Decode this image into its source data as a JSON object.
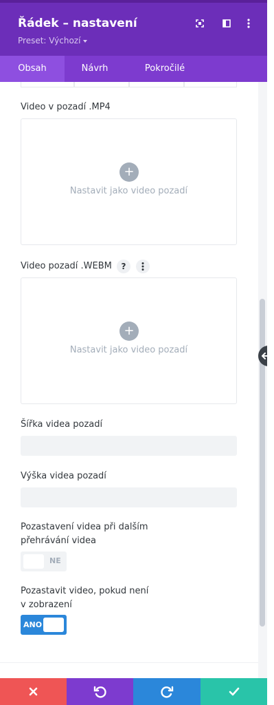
{
  "header": {
    "title": "Řádek – nastavení",
    "preset_label": "Preset: Výchozí",
    "icons": [
      "fullscreen-icon",
      "split-view-icon",
      "more-vertical-icon"
    ],
    "background": "#6c2eb9"
  },
  "tabs": [
    {
      "label": "Obsah",
      "active": true
    },
    {
      "label": "Návrh",
      "active": false
    },
    {
      "label": "Pokročilé",
      "active": false
    }
  ],
  "content": {
    "mp4": {
      "label": "Video v pozadí .MP4",
      "upload_text": "Nastavit jako video pozadí"
    },
    "webm": {
      "label": "Video pozadí .WEBM",
      "help_icon": "?",
      "upload_text": "Nastavit jako video pozadí"
    },
    "width": {
      "label": "Šířka videa pozadí",
      "value": ""
    },
    "height": {
      "label": "Výška videa pozadí",
      "value": ""
    },
    "pause_other": {
      "label_line1": "Pozastavení videa při dalším",
      "label_line2": "přehrávání videa",
      "toggle_text": "NE",
      "on": false
    },
    "pause_hidden": {
      "label_line1": "Pozastavit video, pokud není",
      "label_line2": "v zobrazení",
      "toggle_text": "ANO",
      "on": true
    }
  },
  "footer": {
    "buttons": [
      {
        "name": "discard",
        "icon": "close-icon",
        "color": "#ef5555"
      },
      {
        "name": "undo",
        "icon": "undo-icon",
        "color": "#7d3bcf"
      },
      {
        "name": "redo",
        "icon": "redo-icon",
        "color": "#2b87da"
      },
      {
        "name": "save",
        "icon": "check-icon",
        "color": "#29c4a9"
      }
    ]
  },
  "colors": {
    "accent": "#7d3bcf",
    "toggle_on": "#2b87da",
    "muted": "#a3adb9"
  }
}
